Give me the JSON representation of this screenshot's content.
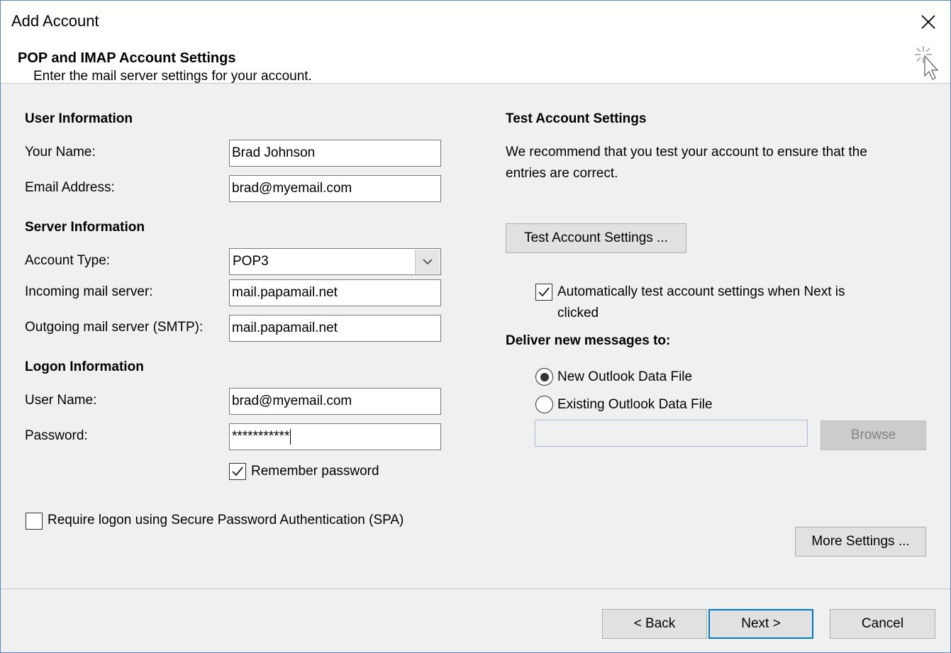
{
  "window": {
    "title": "Add Account"
  },
  "header": {
    "title": "POP and IMAP Account Settings",
    "subtitle": "Enter the mail server settings for your account."
  },
  "user_info": {
    "heading": "User Information",
    "name_label": "Your Name:",
    "name_value": "Brad Johnson",
    "email_label": "Email Address:",
    "email_value": "brad@myemail.com"
  },
  "server_info": {
    "heading": "Server Information",
    "account_type_label": "Account Type:",
    "account_type_value": "POP3",
    "incoming_label": "Incoming mail server:",
    "incoming_value": "mail.papamail.net",
    "outgoing_label": "Outgoing mail server (SMTP):",
    "outgoing_value": "mail.papamail.net"
  },
  "logon_info": {
    "heading": "Logon Information",
    "username_label": "User Name:",
    "username_value": "brad@myemail.com",
    "password_label": "Password:",
    "password_value": "***********",
    "remember_label": "Remember password",
    "remember_checked": true,
    "spa_label": "Require logon using Secure Password Authentication (SPA)",
    "spa_checked": false
  },
  "test_settings": {
    "heading": "Test Account Settings",
    "description_line1": "We recommend that you test your account to ensure that the",
    "description_line2": "entries are correct.",
    "test_button": "Test Account Settings ...",
    "auto_test_line1": "Automatically test account settings when Next is",
    "auto_test_line2": "clicked",
    "auto_test_checked": true
  },
  "deliver": {
    "heading": "Deliver new messages to:",
    "option_new": "New Outlook Data File",
    "option_existing": "Existing Outlook Data File",
    "selected": "new",
    "browse_button": "Browse",
    "more_settings_button": "More Settings ..."
  },
  "footer": {
    "back_button": "< Back",
    "next_button": "Next >",
    "cancel_button": "Cancel"
  },
  "colors": {
    "accent": "#0078d7",
    "window_border": "#5b87c7",
    "dialog_bg": "#f0f0f0"
  }
}
